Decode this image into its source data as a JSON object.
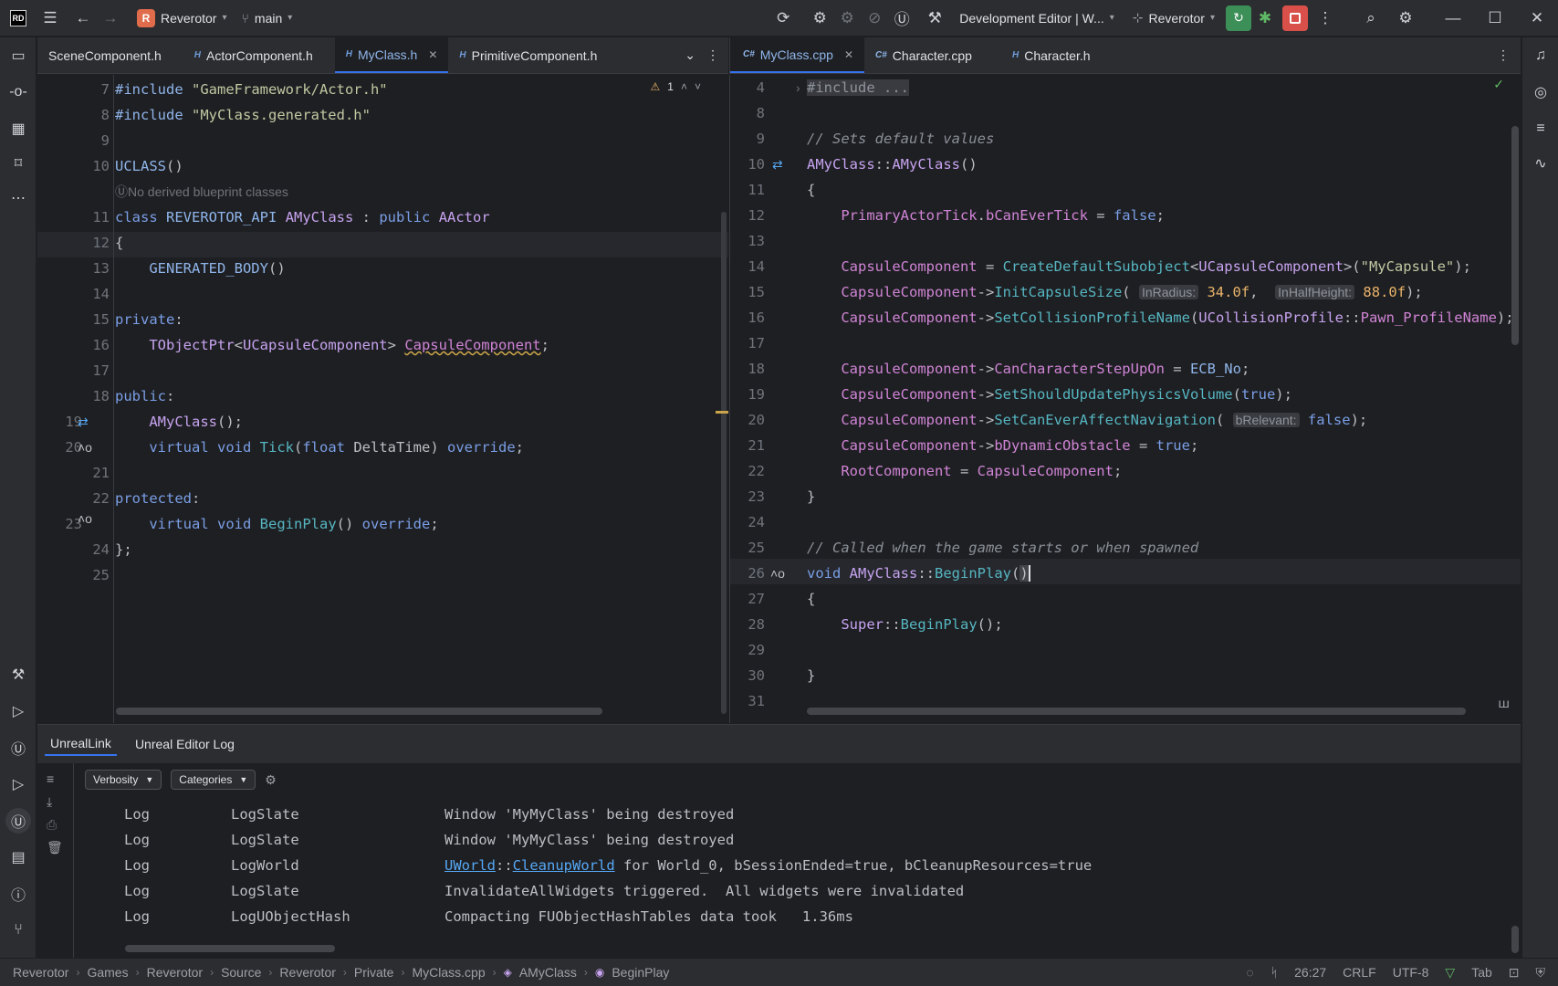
{
  "titlebar": {
    "project": "Reverotor",
    "branch": "main",
    "config": "Development Editor | W...",
    "run_target": "Reverotor",
    "project_initial": "R"
  },
  "left_tabs": [
    {
      "label": "SceneComponent.h",
      "type": ""
    },
    {
      "label": "ActorComponent.h",
      "type": "H"
    },
    {
      "label": "MyClass.h",
      "type": "H",
      "active": true
    },
    {
      "label": "PrimitiveComponent.h",
      "type": "H"
    }
  ],
  "right_tabs": [
    {
      "label": "MyClass.cpp",
      "type": "C#",
      "active": true
    },
    {
      "label": "Character.cpp",
      "type": "C#"
    },
    {
      "label": "Character.h",
      "type": "H"
    }
  ],
  "left_editor": {
    "warning_count": "1",
    "line_numbers": [
      "7",
      "8",
      "9",
      "10",
      "11",
      "12",
      "13",
      "14",
      "15",
      "16",
      "17",
      "18",
      "19",
      "20",
      "21",
      "22",
      "23",
      "24",
      "25"
    ],
    "hint": "No derived blueprint classes"
  },
  "right_editor": {
    "line_numbers": [
      "4",
      "8",
      "9",
      "10",
      "11",
      "12",
      "13",
      "14",
      "15",
      "16",
      "17",
      "18",
      "19",
      "20",
      "21",
      "22",
      "23",
      "24",
      "25",
      "26",
      "27",
      "28",
      "29",
      "30",
      "31"
    ]
  },
  "bottom": {
    "tabs": [
      "UnrealLink",
      "Unreal Editor Log"
    ],
    "verbosity": "Verbosity",
    "categories": "Categories",
    "rows": [
      {
        "level": "Log",
        "category": "LogSlate",
        "message": "Window 'MyMyClass' being destroyed"
      },
      {
        "level": "Log",
        "category": "LogSlate",
        "message": "Window 'MyMyClass' being destroyed"
      },
      {
        "level": "Log",
        "category": "LogWorld",
        "link1": "UWorld",
        "sep": "::",
        "link2": "CleanupWorld",
        "message": " for World_0, bSessionEnded=true, bCleanupResources=true"
      },
      {
        "level": "Log",
        "category": "LogSlate",
        "message": "InvalidateAllWidgets triggered.  All widgets were invalidated"
      },
      {
        "level": "Log",
        "category": "LogUObjectHash",
        "message": "Compacting FUObjectHashTables data took   1.36ms"
      }
    ]
  },
  "statusbar": {
    "crumbs": [
      "Reverotor",
      "Games",
      "Reverotor",
      "Source",
      "Reverotor",
      "Private",
      "MyClass.cpp",
      "AMyClass",
      "BeginPlay"
    ],
    "position": "26:27",
    "line_ending": "CRLF",
    "encoding": "UTF-8",
    "indent": "Tab"
  }
}
